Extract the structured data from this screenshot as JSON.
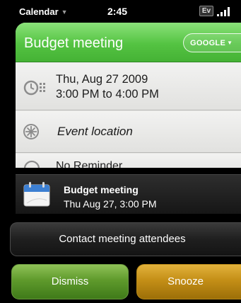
{
  "status_bar": {
    "app_name": "Calendar",
    "time": "2:45",
    "network_badge": "Ev",
    "signal_icon": "signal-bars-icon"
  },
  "event": {
    "title": "Budget meeting",
    "calendar_source": "GOOGLE",
    "date_line": "Thu, Aug 27 2009",
    "time_line": "3:00 PM to 4:00 PM",
    "location_placeholder": "Event location",
    "next_row_text": "No Reminder"
  },
  "notification": {
    "title": "Budget meeting",
    "subtitle": "Thu Aug 27, 3:00 PM",
    "icon": "calendar-icon"
  },
  "actions": {
    "contact_label": "Contact meeting attendees",
    "dismiss_label": "Dismiss",
    "snooze_label": "Snooze"
  },
  "colors": {
    "header_green": "#54c342",
    "dismiss_green": "#5f9a2c",
    "snooze_amber": "#c48f17"
  }
}
